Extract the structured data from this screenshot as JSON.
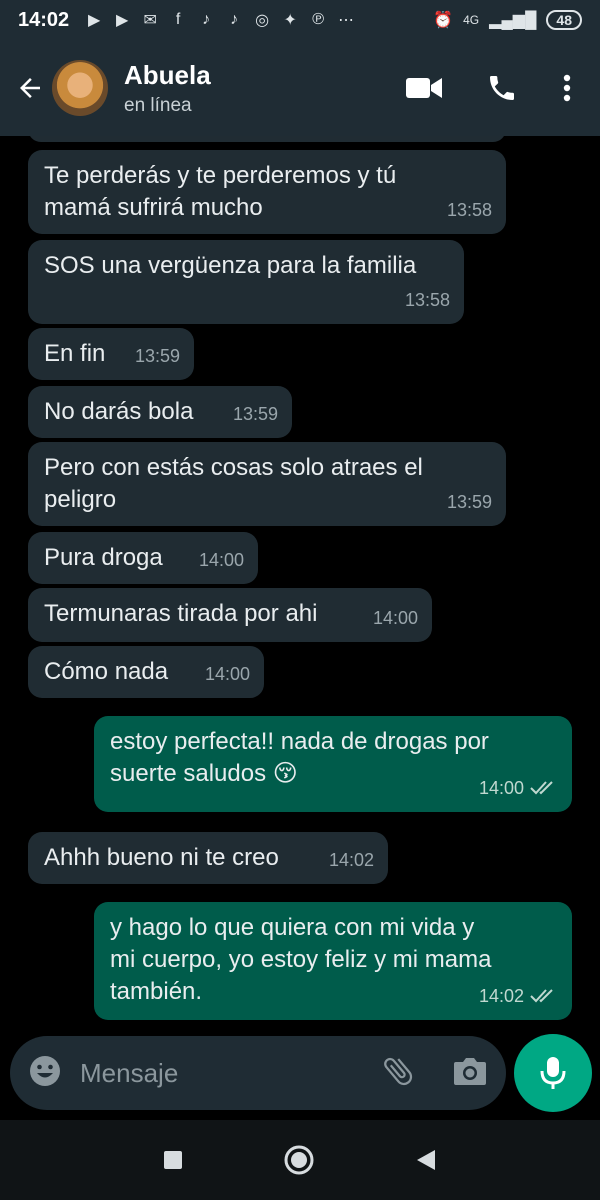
{
  "status_bar": {
    "time": "14:02",
    "network": "4G",
    "battery": "48"
  },
  "header": {
    "contact_name": "Abuela",
    "contact_status": "en línea"
  },
  "messages": [
    {
      "direction": "in",
      "text_line1": "Te perderás y te perderemos y tú",
      "text_line2": "mamá sufrirá mucho",
      "time": "13:58"
    },
    {
      "direction": "in",
      "text_line1": "SOS una vergüenza para la familia",
      "time": "13:58"
    },
    {
      "direction": "in",
      "text_line1": "En fin",
      "time": "13:59"
    },
    {
      "direction": "in",
      "text_line1": "No darás bola",
      "time": "13:59"
    },
    {
      "direction": "in",
      "text_line1": "Pero con estás cosas solo atraes el",
      "text_line2": "peligro",
      "time": "13:59"
    },
    {
      "direction": "in",
      "text_line1": "Pura droga",
      "time": "14:00"
    },
    {
      "direction": "in",
      "text_line1": "Termunaras tirada por ahi",
      "time": "14:00"
    },
    {
      "direction": "in",
      "text_line1": "Cómo nada",
      "time": "14:00"
    },
    {
      "direction": "out",
      "text_line1": "estoy perfecta!! nada de drogas por",
      "text_line2": "suerte saludos 😚",
      "time": "14:00"
    },
    {
      "direction": "in",
      "text_line1": "Ahhh bueno ni te creo",
      "time": "14:02"
    },
    {
      "direction": "out",
      "text_line1": "y hago lo que quiera con mi vida y",
      "text_line2": "mi cuerpo, yo estoy feliz y mi mama",
      "text_line3": "también.",
      "time": "14:02"
    }
  ],
  "composer": {
    "placeholder": "Mensaje"
  },
  "colors": {
    "incoming_bubble": "#202c33",
    "outgoing_bubble": "#005c4b",
    "accent": "#00a884",
    "header_bg": "#1f2c34"
  }
}
